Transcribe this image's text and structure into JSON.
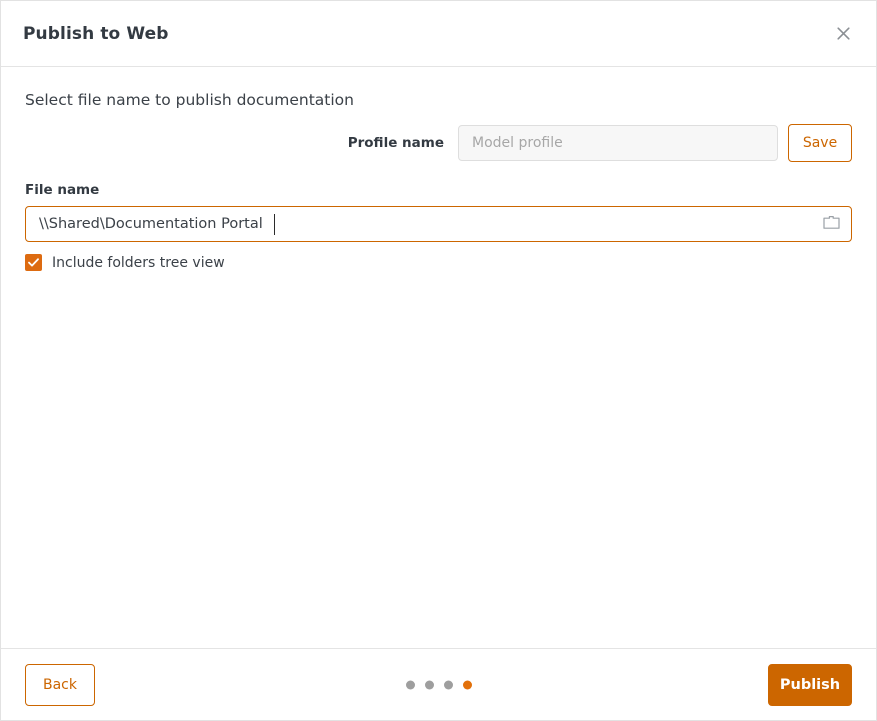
{
  "dialog": {
    "title": "Publish to Web",
    "close_icon": "close-icon"
  },
  "body": {
    "heading": "Select file name to publish documentation",
    "profile": {
      "label": "Profile name",
      "value": "",
      "placeholder": "Model profile",
      "save_label": "Save"
    },
    "file": {
      "label": "File name",
      "value": "\\\\Shared\\Documentation Portal",
      "placeholder": "",
      "browse_icon": "folder-icon"
    },
    "checkbox": {
      "label": "Include folders tree view",
      "checked": true
    }
  },
  "footer": {
    "back_label": "Back",
    "publish_label": "Publish",
    "steps": {
      "total": 4,
      "active_index": 3
    }
  },
  "colors": {
    "accent": "#cc6600",
    "accent_dot": "#e2700a",
    "checkbox": "#dd6b11",
    "dot_inactive": "#9e9e9e",
    "text": "#3b4148",
    "border": "#e4e4e4"
  }
}
